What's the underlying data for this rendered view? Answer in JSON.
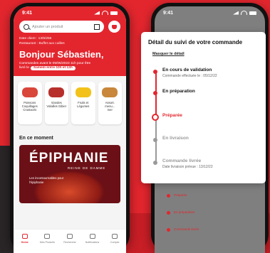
{
  "left_phone": {
    "time": "9:41",
    "search_placeholder": "Ajouter un produit",
    "meta_line1": "Date client : 13/6/256",
    "meta_line2": "Restaurant : Buffet aux cuilles",
    "greeting": "Bonjour Sébastien,",
    "order_line1": "Commandes avant le 05/05/2023 11h pour être",
    "order_line2_prefix": "livré le",
    "order_pill": "Samedi entre 10h et 12h",
    "categories": [
      {
        "label": "Poissons\nCoquillages\nCrustacés",
        "color": "#d9463a"
      },
      {
        "label": "Viandes\nVolailles Gibier",
        "color": "#b7302c"
      },
      {
        "label": "Fruits et\nLégumes",
        "color": "#f2c21b"
      },
      {
        "label": "Assort.\nmenu...\nmer",
        "color": "#c8873a"
      }
    ],
    "section_title": "En ce moment",
    "banner_title": "ÉPIPHANIE",
    "banner_subtitle": "REINE DE DAMME",
    "banner_desc": "Les incontournables pour l'épiphanie",
    "nav": [
      {
        "label": "Home",
        "active": true
      },
      {
        "label": "Mes Produits",
        "active": false
      },
      {
        "label": "Recherche",
        "active": false
      },
      {
        "label": "Notifications",
        "active": false
      },
      {
        "label": "Compte",
        "active": false
      }
    ]
  },
  "right_phone": {
    "time": "9:41",
    "card_title": "Détail du suivi de votre commande",
    "hide_link": "Masquer le détail",
    "steps": [
      {
        "title": "En cours de validation",
        "sub": "Commande effectuée le : 05/12/22",
        "state": "done"
      },
      {
        "title": "En préparation",
        "sub": "",
        "state": "done"
      },
      {
        "title": "Préparée",
        "sub": "",
        "state": "current"
      },
      {
        "title": "En livraison",
        "sub": "",
        "state": "pending"
      },
      {
        "title": "Commande livrée",
        "sub": "Date livraison prévue : 13/12/22",
        "state": "pending"
      }
    ],
    "bg_steps": [
      "Préparée",
      "En préparation",
      "Commande livrée"
    ],
    "accent": "#e3262e",
    "pending_color": "#9a9a9a"
  }
}
